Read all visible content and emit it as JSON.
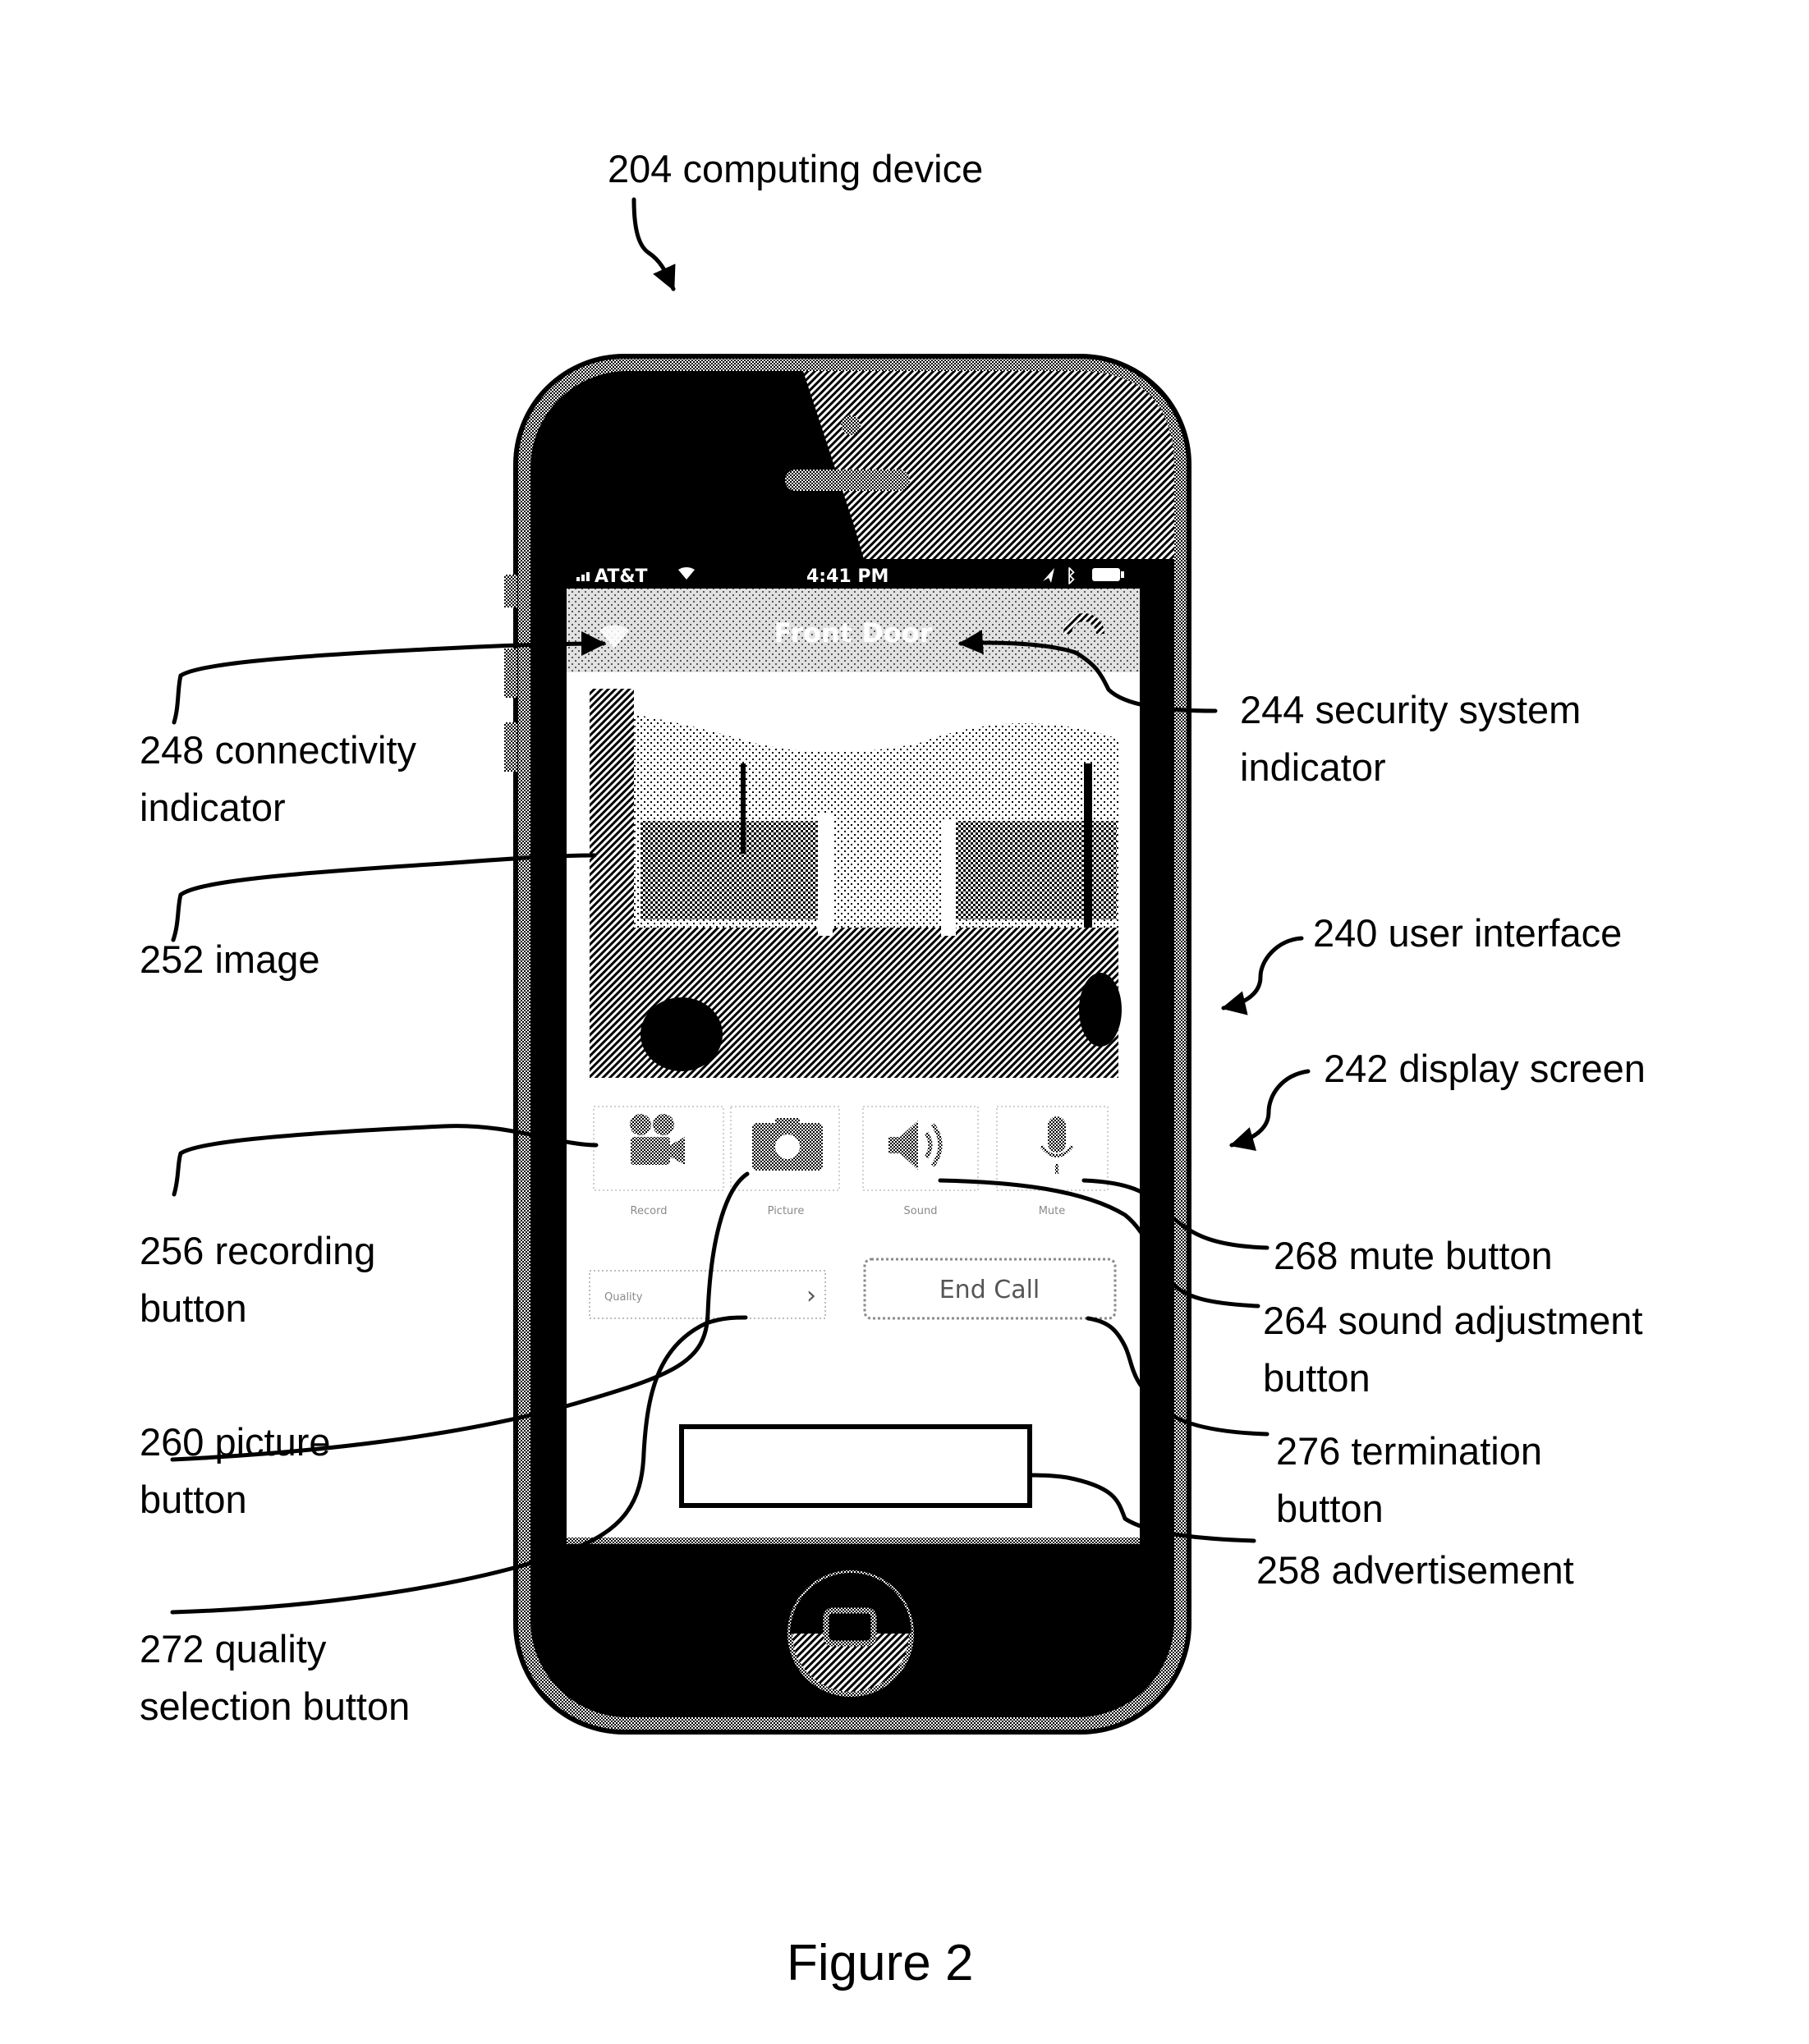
{
  "figure": {
    "caption": "Figure 2"
  },
  "labels": {
    "computing_device": "204 computing device",
    "connectivity_indicator": [
      "248 connectivity",
      "indicator"
    ],
    "image": "252 image",
    "recording_button": [
      "256 recording",
      "button"
    ],
    "picture_button": [
      "260 picture",
      "button"
    ],
    "quality_selection_button": [
      "272 quality",
      "selection button"
    ],
    "security_system_indicator": [
      "244 security system",
      "indicator"
    ],
    "user_interface": "240 user interface",
    "display_screen": "242 display screen",
    "mute_button": "268 mute button",
    "sound_adjustment_button": [
      "264 sound adjustment",
      "button"
    ],
    "termination_button": [
      "276 termination",
      "button"
    ],
    "advertisement": "258 advertisement"
  },
  "phone": {
    "status_bar": {
      "carrier": "AT&T",
      "time": "4:41 PM",
      "icons": [
        "signal-icon",
        "wifi-icon",
        "location-icon",
        "bluetooth-icon",
        "battery-icon"
      ]
    },
    "nav_bar": {
      "title": "Front Door",
      "left_icon": "wifi-connectivity-icon",
      "right_icon": "security-system-icon"
    },
    "controls": [
      {
        "label": "Record",
        "icon": "video-camera-icon"
      },
      {
        "label": "Picture",
        "icon": "camera-icon"
      },
      {
        "label": "Sound",
        "icon": "speaker-icon"
      },
      {
        "label": "Mute",
        "icon": "microphone-icon"
      }
    ],
    "quality": {
      "label": "Quality",
      "chevron": "›"
    },
    "end_call": {
      "label": "End Call"
    },
    "advertisement": {
      "text": ""
    }
  },
  "colors": {
    "ink": "#000000",
    "paper": "#ffffff",
    "halftone_light": "#cfcfcf",
    "halftone_mid": "#9a9a9a",
    "halftone_dark": "#5a5a5a"
  }
}
